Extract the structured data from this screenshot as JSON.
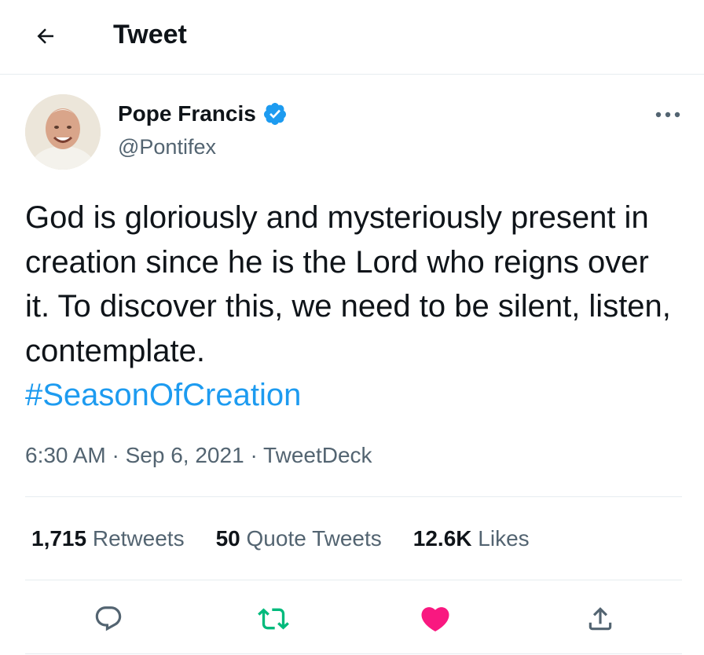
{
  "header": {
    "title": "Tweet",
    "back_icon": "arrow-left-icon"
  },
  "author": {
    "name": "Pope Francis",
    "handle": "@Pontifex",
    "verified": true,
    "verified_icon": "verified-badge-icon"
  },
  "tweet": {
    "text": "God is gloriously and mysteriously present in creation since he is the Lord who reigns over it. To discover this, we need to be silent, listen, contemplate.",
    "hashtag": "#SeasonOfCreation",
    "time": "6:30 AM",
    "date": "Sep 6, 2021",
    "source": "TweetDeck",
    "separator": "·"
  },
  "stats": {
    "retweets_count": "1,715",
    "retweets_label": "Retweets",
    "quotes_count": "50",
    "quotes_label": "Quote Tweets",
    "likes_count": "12.6K",
    "likes_label": "Likes"
  },
  "actions": [
    {
      "name": "reply",
      "icon": "reply-icon"
    },
    {
      "name": "retweet",
      "icon": "retweet-icon"
    },
    {
      "name": "like",
      "icon": "heart-icon"
    },
    {
      "name": "share",
      "icon": "share-icon"
    }
  ],
  "colors": {
    "accent": "#1d9bf0",
    "retweet": "#00ba7c",
    "like": "#f91880",
    "secondary_text": "#536471",
    "divider": "#e6ecf0"
  }
}
